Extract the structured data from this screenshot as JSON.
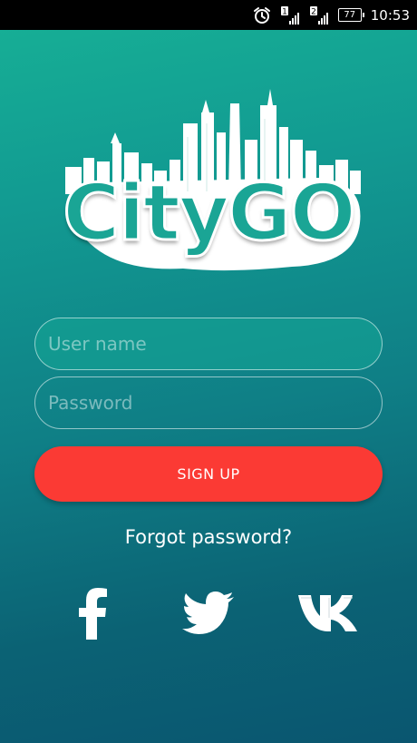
{
  "status_bar": {
    "time": "10:53",
    "battery": "77",
    "sim1": "1",
    "sim2": "2"
  },
  "logo": {
    "text": "CityGO"
  },
  "form": {
    "username_placeholder": "User name",
    "password_placeholder": "Password",
    "signup_label": "SIGN UP",
    "forgot_label": "Forgot password?"
  },
  "social": [
    "facebook-icon",
    "twitter-icon",
    "vk-icon"
  ],
  "colors": {
    "gradient_top": "#17b196",
    "gradient_bottom": "#0a5670",
    "signup": "#fb3a34",
    "logo_fill": "#1aa595"
  }
}
